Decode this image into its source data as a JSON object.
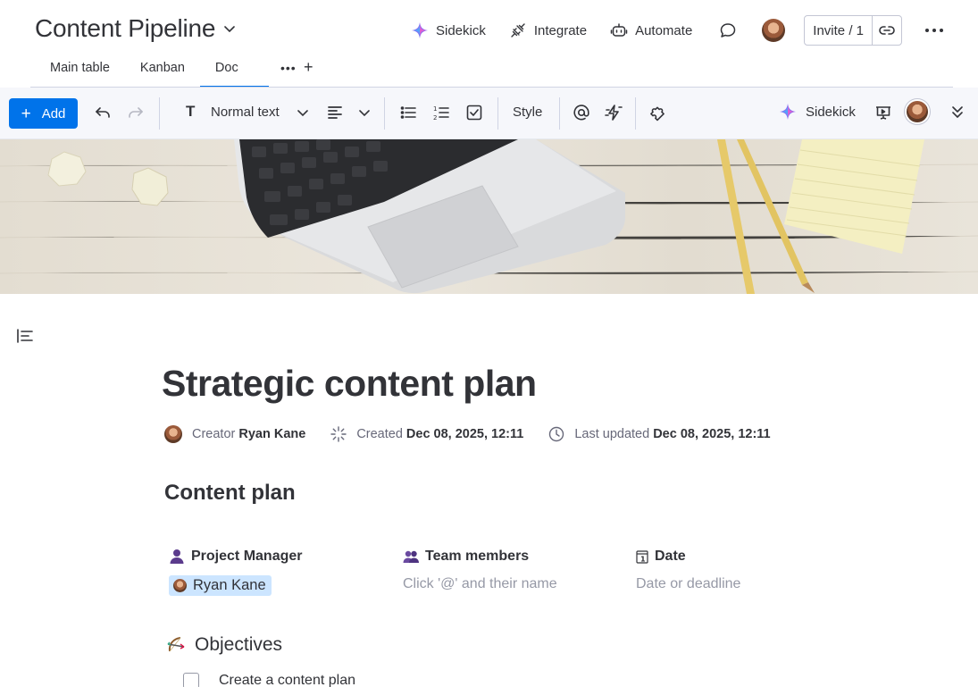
{
  "board": {
    "title": "Content Pipeline",
    "actions": {
      "sidekick": "Sidekick",
      "integrate": "Integrate",
      "automate": "Automate",
      "invite": "Invite / 1"
    },
    "tabs": [
      {
        "label": "Main table",
        "active": false
      },
      {
        "label": "Kanban",
        "active": false
      },
      {
        "label": "Doc",
        "active": true
      }
    ]
  },
  "toolbar": {
    "add_label": "Add",
    "text_style": "Normal text",
    "style_label": "Style",
    "sidekick_label": "Sidekick"
  },
  "document": {
    "title": "Strategic content plan",
    "meta": {
      "creator_label": "Creator",
      "creator_name": "Ryan Kane",
      "created_label": "Created",
      "created_value": "Dec 08, 2025, 12:11",
      "updated_label": "Last updated",
      "updated_value": "Dec 08, 2025, 12:11"
    },
    "section_heading": "Content plan",
    "columns": {
      "project_manager": {
        "label": "Project Manager",
        "value": "Ryan Kane"
      },
      "team_members": {
        "label": "Team members",
        "placeholder": "Click '@' and their name"
      },
      "date": {
        "label": "Date",
        "placeholder": "Date or deadline"
      }
    },
    "objectives": {
      "heading": "Objectives",
      "items": [
        {
          "label": "Create a content plan",
          "checked": false
        }
      ]
    }
  },
  "colors": {
    "accent": "#0073ea",
    "text": "#323338",
    "muted": "#676879",
    "chip_bg": "#cce5ff"
  },
  "icons": [
    "chevron-down-icon",
    "sidekick-icon",
    "integrate-icon",
    "automate-icon",
    "comment-icon",
    "link-icon",
    "more-icon",
    "undo-icon",
    "redo-icon",
    "align-left-icon",
    "bullet-list-icon",
    "numbered-list-icon",
    "checklist-icon",
    "mention-icon",
    "lightning-icon",
    "puzzle-icon",
    "present-icon",
    "collapse-icon",
    "toc-icon",
    "sparkle-icon",
    "clock-icon",
    "person-icon",
    "team-icon",
    "calendar-icon",
    "bow-arrow-icon"
  ]
}
